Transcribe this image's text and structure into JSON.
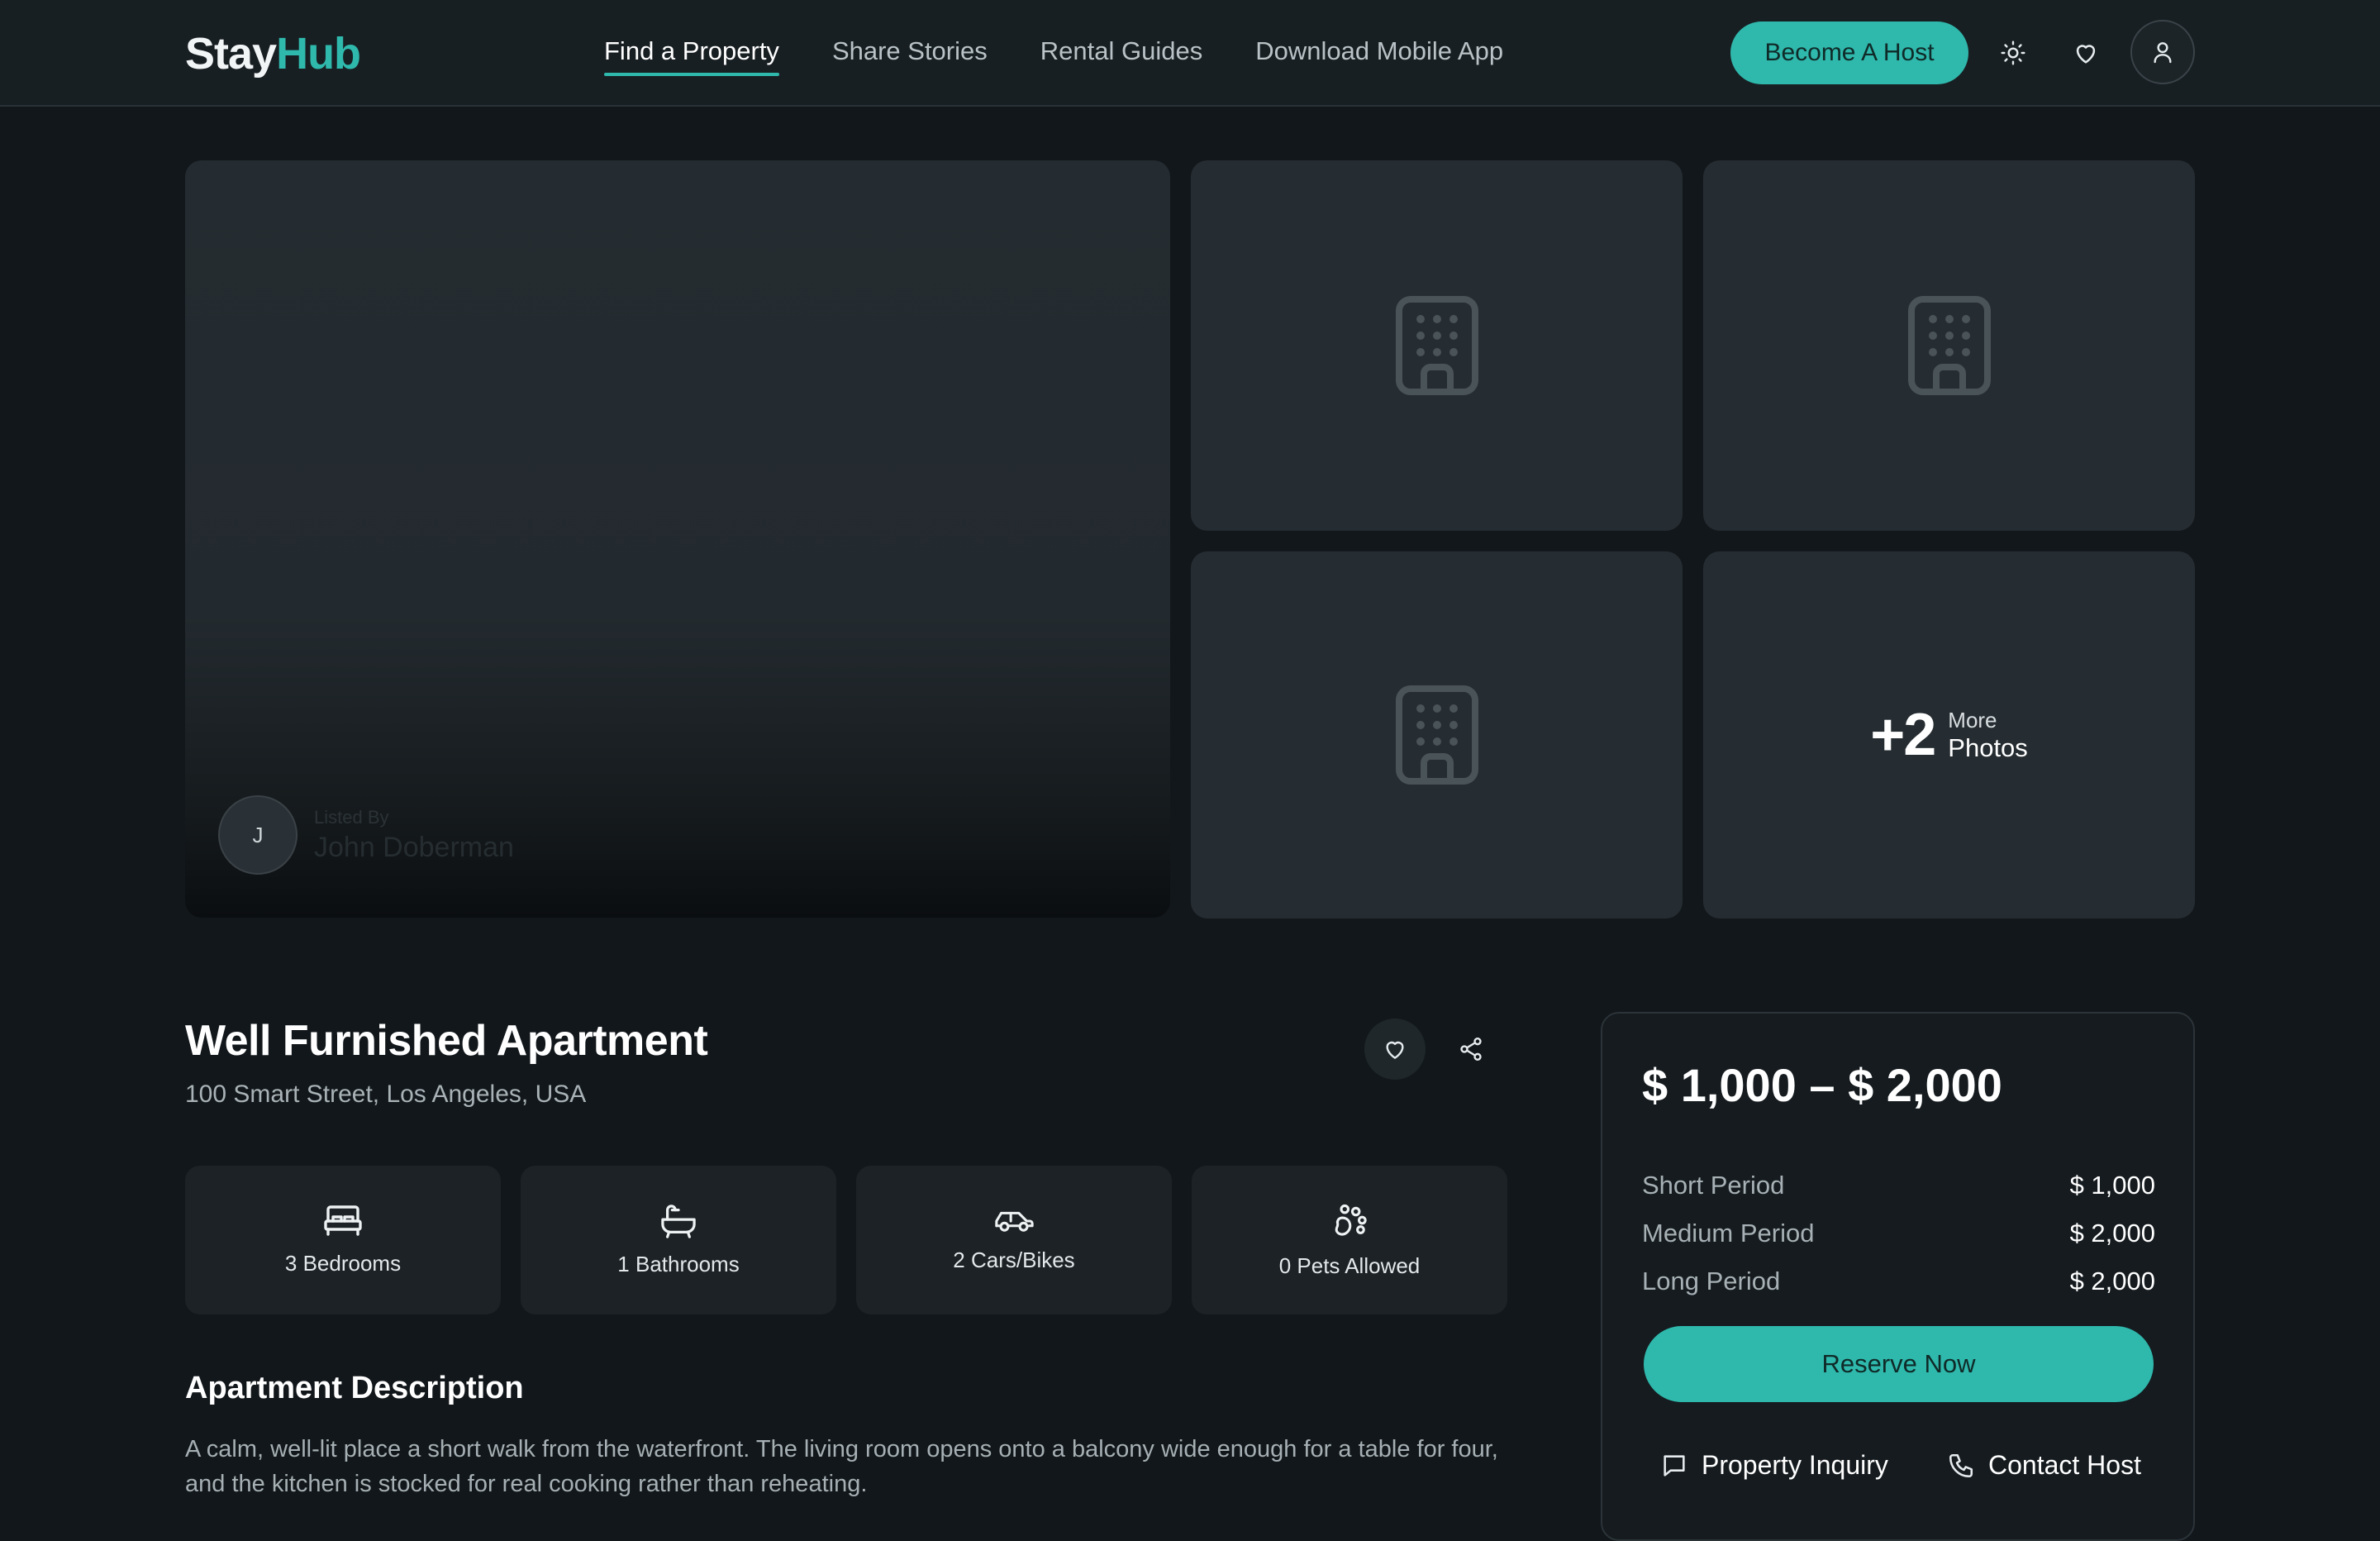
{
  "header": {
    "logo_part1": "Stay",
    "logo_part2": "Hub",
    "nav": [
      {
        "label": "Find a Property",
        "active": true
      },
      {
        "label": "Share Stories"
      },
      {
        "label": "Rental Guides"
      },
      {
        "label": "Download Mobile App"
      }
    ],
    "host_button": "Become A Host",
    "icons": [
      "sun-icon",
      "heart-icon",
      "user-icon"
    ]
  },
  "gallery": {
    "listed_by_label": "Listed By",
    "listed_by_name": "John Doberman",
    "avatar_initial": "J",
    "more_count": "+2",
    "more_label_1": "More",
    "more_label_2": "Photos",
    "placeholder_icon": "building-icon"
  },
  "property": {
    "title": "Well Furnished Apartment",
    "address": "100 Smart Street, Los Angeles, USA",
    "features": [
      {
        "icon": "bed-icon",
        "label": "3 Bedrooms"
      },
      {
        "icon": "bathtub-icon",
        "label": "1 Bathrooms"
      },
      {
        "icon": "car-icon",
        "label": "2 Cars/Bikes"
      },
      {
        "icon": "paw-icon",
        "label": "0 Pets Allowed"
      }
    ],
    "description_title": "Apartment Description",
    "description": "A calm, well-lit place a short walk from the waterfront. The living room opens onto a balcony wide enough for a table for four, and the kitchen is stocked for real cooking rather than reheating."
  },
  "pricing": {
    "range": "$ 1,000 – $ 2,000",
    "rows": [
      {
        "label": "Short Period",
        "value": "$ 1,000"
      },
      {
        "label": "Medium Period",
        "value": "$ 2,000"
      },
      {
        "label": "Long Period",
        "value": "$ 2,000"
      }
    ],
    "reserve": "Reserve Now",
    "inquiry": "Property Inquiry",
    "contact": "Contact Host"
  },
  "colors": {
    "accent": "#2fb8ac",
    "background": "#12171b",
    "header": "#181f23",
    "tile": "#262d32"
  }
}
